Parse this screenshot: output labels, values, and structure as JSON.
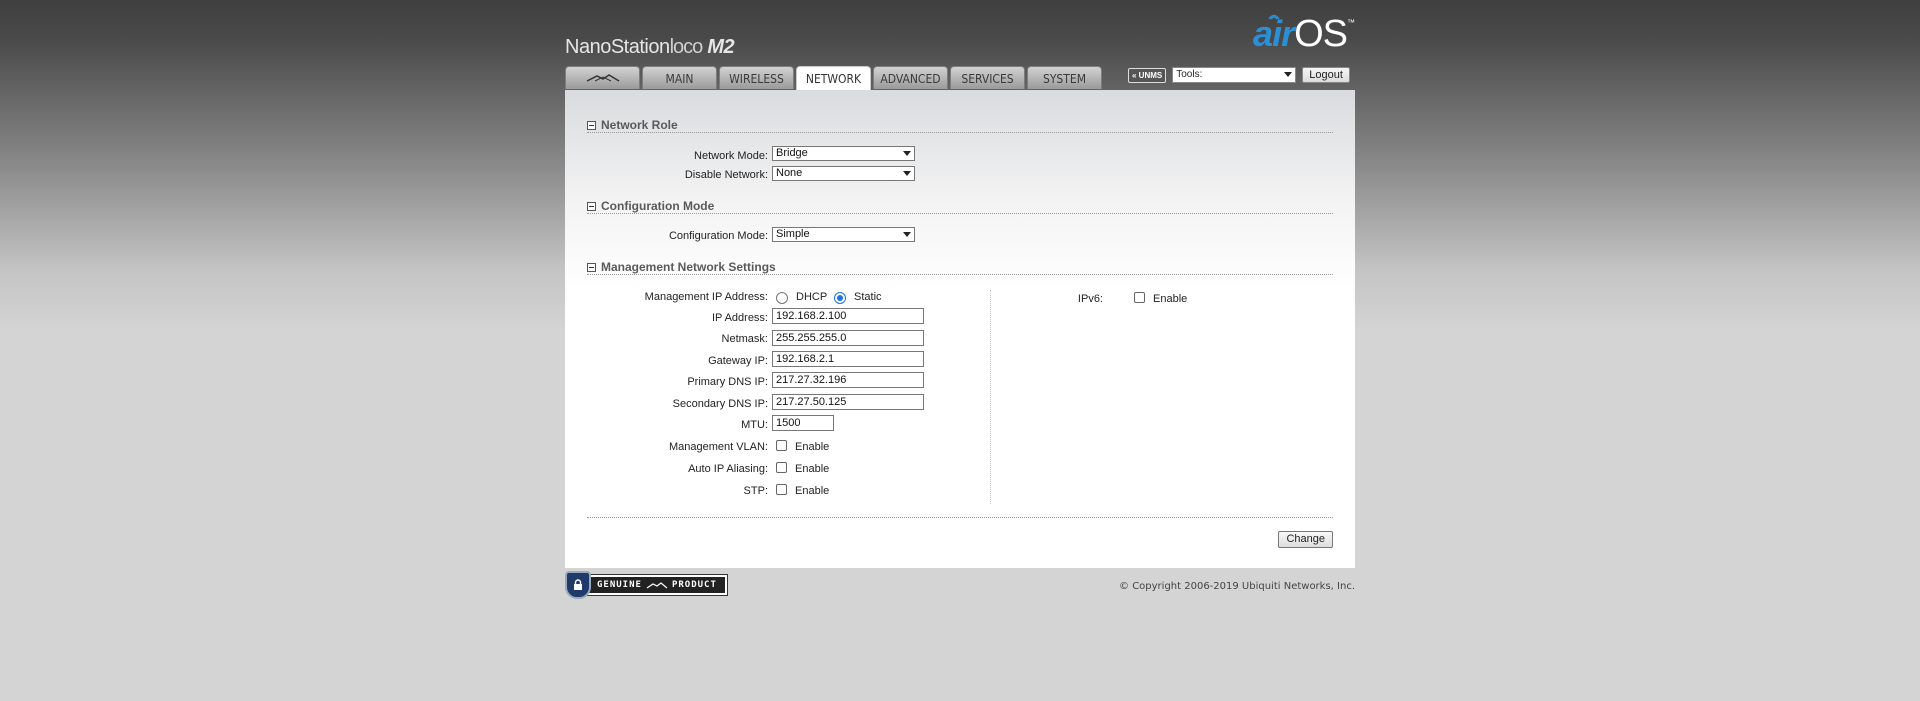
{
  "header": {
    "product_name": "NanoStation",
    "product_variant": "loco",
    "product_model": "M2",
    "logo_air": "air",
    "logo_os": "OS",
    "logo_tm": "™"
  },
  "tabs": [
    {
      "label": "",
      "icon": "ubiquiti-logo-icon",
      "active": false
    },
    {
      "label": "MAIN",
      "active": false
    },
    {
      "label": "WIRELESS",
      "active": false
    },
    {
      "label": "NETWORK",
      "active": true
    },
    {
      "label": "ADVANCED",
      "active": false
    },
    {
      "label": "SERVICES",
      "active": false
    },
    {
      "label": "SYSTEM",
      "active": false
    }
  ],
  "topright": {
    "unms_label": "« UNMS",
    "tools_value": "Tools:",
    "logout_label": "Logout"
  },
  "sections": {
    "network_role": "Network Role",
    "configuration_mode": "Configuration Mode",
    "management_network": "Management Network Settings"
  },
  "fields": {
    "network_mode_label": "Network Mode:",
    "network_mode_value": "Bridge",
    "disable_network_label": "Disable Network:",
    "disable_network_value": "None",
    "configuration_mode_label": "Configuration Mode:",
    "configuration_mode_value": "Simple",
    "mgmt_ip_label": "Management IP Address:",
    "dhcp_label": "DHCP",
    "static_label": "Static",
    "ip_label": "IP Address:",
    "ip_value": "192.168.2.100",
    "netmask_label": "Netmask:",
    "netmask_value": "255.255.255.0",
    "gateway_label": "Gateway IP:",
    "gateway_value": "192.168.2.1",
    "dns1_label": "Primary DNS IP:",
    "dns1_value": "217.27.32.196",
    "dns2_label": "Secondary DNS IP:",
    "dns2_value": "217.27.50.125",
    "mtu_label": "MTU:",
    "mtu_value": "1500",
    "mgmt_vlan_label": "Management VLAN:",
    "auto_ip_label": "Auto IP Aliasing:",
    "stp_label": "STP:",
    "enable_label": "Enable",
    "ipv6_label": "IPv6:"
  },
  "buttons": {
    "change": "Change"
  },
  "footer": {
    "genuine_left": "GENUINE",
    "genuine_right": "PRODUCT",
    "copyright": "© Copyright 2006-2019 Ubiquiti Networks, Inc."
  },
  "colors": {
    "accent_blue": "#2b8fd6",
    "radio_selected": "#1a73e8"
  }
}
